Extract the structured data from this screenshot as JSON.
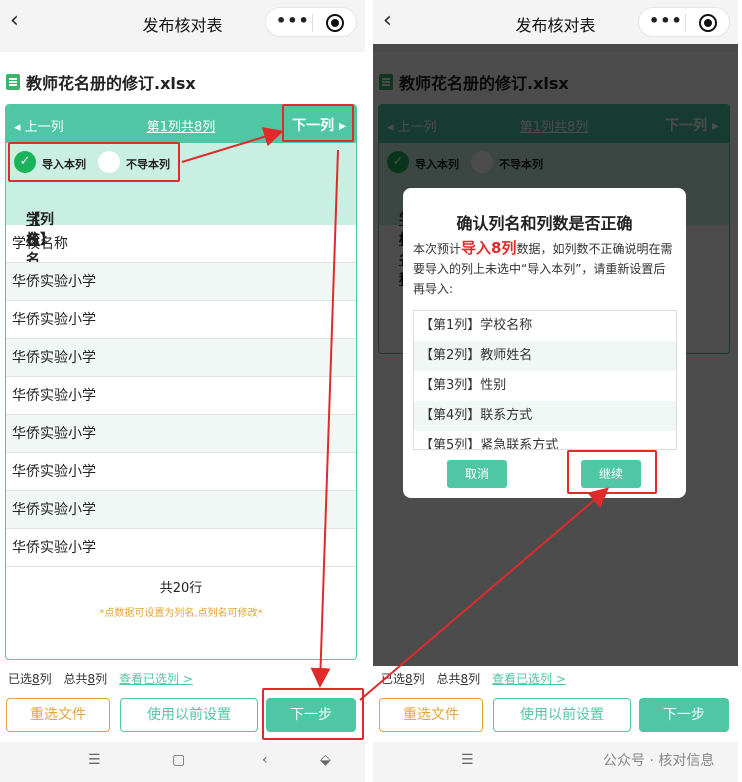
{
  "header": {
    "back_glyph": "‹",
    "title": "发布核对表",
    "menu_glyph": "•••"
  },
  "file": {
    "name": "教师花名册的修订.xlsx"
  },
  "nav": {
    "prev": "◂ 上一列",
    "position": "第1列共8列",
    "next": "下一列 ▸"
  },
  "options": {
    "import_label": "导入本列",
    "skip_label": "不导本列",
    "check_glyph": "✓"
  },
  "column": {
    "prefix": "【列名】",
    "name": "学校名称"
  },
  "rows": [
    "学校名称",
    "华侨实验小学",
    "华侨实验小学",
    "华侨实验小学",
    "华侨实验小学",
    "华侨实验小学",
    "华侨实验小学",
    "华侨实验小学",
    "华侨实验小学"
  ],
  "footer": {
    "total": "共20行",
    "hint": "*点数据可设置为列名,点列名可修改*",
    "selected_label": "已选",
    "selected_count": "8",
    "selected_unit": "列",
    "total_label": "总共",
    "total_count": "8",
    "total_unit": "列",
    "view_selected": "查看已选列 >"
  },
  "buttons": {
    "reselect": "重选文件",
    "previous_settings": "使用以前设置",
    "next_step": "下一步"
  },
  "sysbar": {
    "menu": "☰",
    "home": "▢",
    "back": "‹",
    "down": "⬙"
  },
  "dialog": {
    "title": "确认列名和列数是否正确",
    "text_before": "本次预计",
    "highlight": "导入8列",
    "text_after": "数据，如列数不正确说明在需要导入的列上未选中“导入本列”，请重新设置后再导入:",
    "columns": [
      "【第1列】学校名称",
      "【第2列】教师姓名",
      "【第3列】性别",
      "【第4列】联系方式",
      "【第5列】紧急联系方式"
    ],
    "cancel": "取消",
    "continue": "继续"
  },
  "watermark": "公众号 · 核对信息",
  "colors": {
    "accent": "#4fc7a5",
    "highlight_red": "#e02b2b",
    "orange": "#e4a43a",
    "check_green": "#1bb35a"
  }
}
